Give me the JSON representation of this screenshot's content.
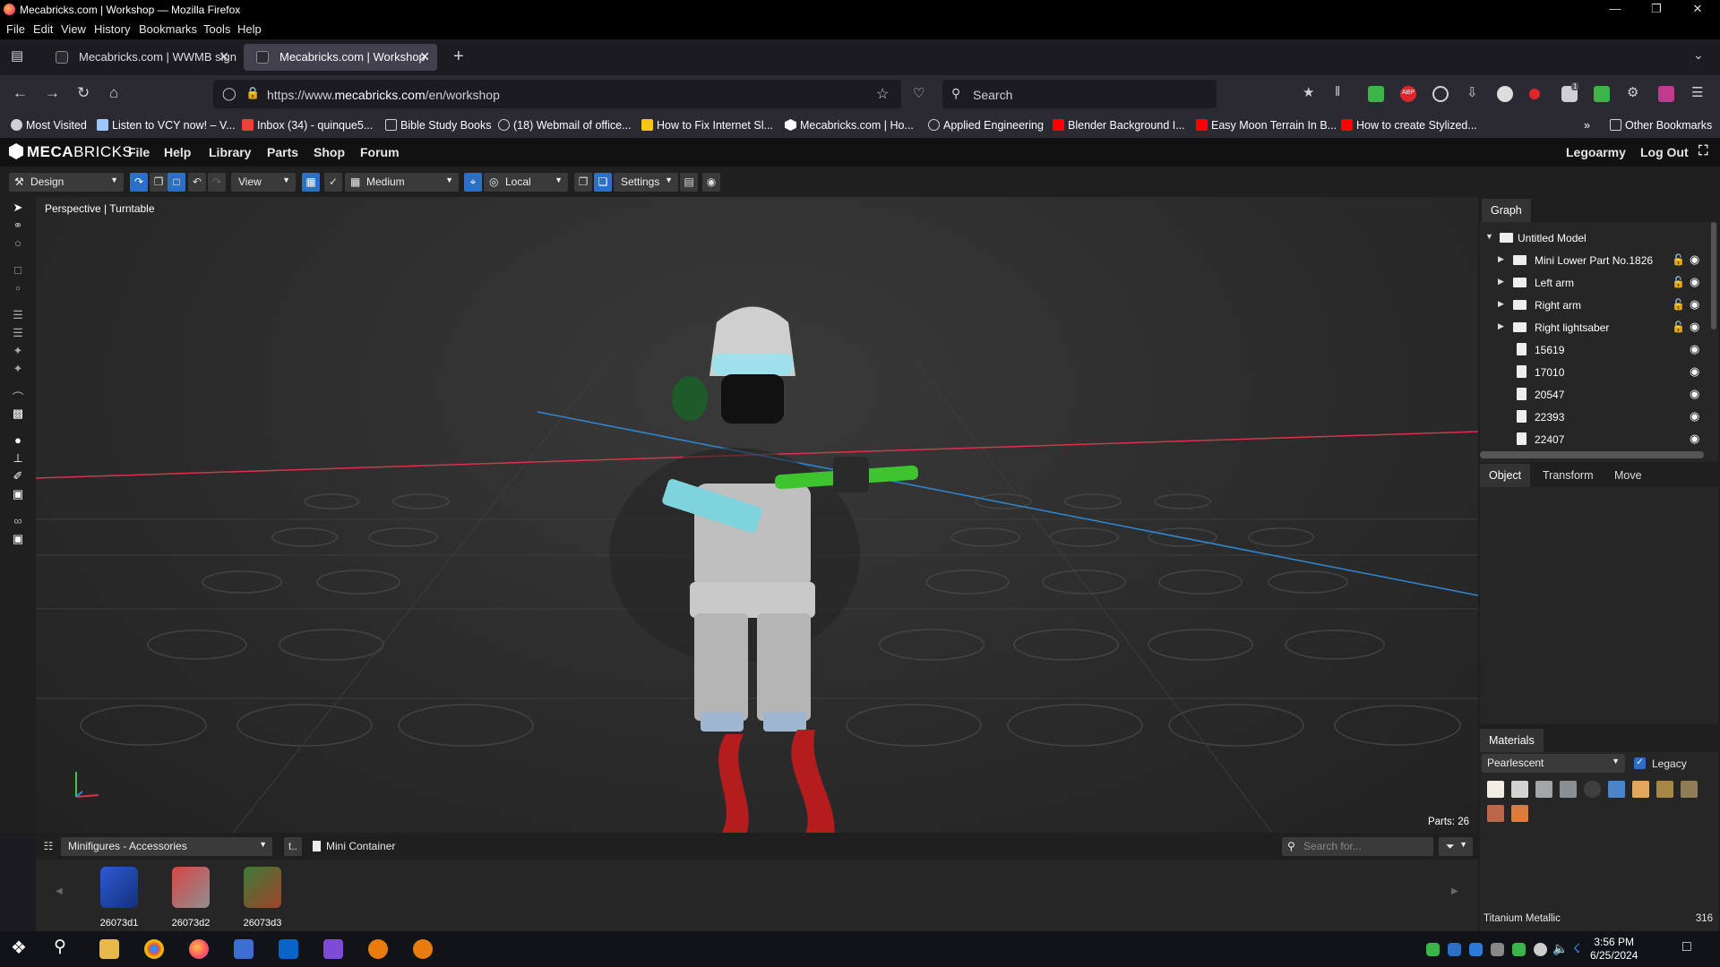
{
  "browser": {
    "window_title": "Mecabricks.com | Workshop — Mozilla Firefox",
    "menu": [
      "File",
      "Edit",
      "View",
      "History",
      "Bookmarks",
      "Tools",
      "Help"
    ],
    "tabs": [
      {
        "label": "Mecabricks.com | WWMB sign",
        "active": false
      },
      {
        "label": "Mecabricks.com | Workshop",
        "active": true
      }
    ],
    "url_prefix": "https://www.",
    "url_domain": "mecabricks.com",
    "url_path": "/en/workshop",
    "search_placeholder": "Search",
    "toolbar_badge": "1",
    "bookmarks": [
      {
        "label": "Most Visited",
        "icon": "gear-icon",
        "color": "#cfcfd8"
      },
      {
        "label": "Listen to VCY now! – V...",
        "icon": "radio-icon",
        "color": "#9ec6ff"
      },
      {
        "label": "Inbox (34) - quinque5...",
        "icon": "gmail-icon",
        "color": "#ea4335"
      },
      {
        "label": "Bible Study Books",
        "icon": "folder-icon",
        "color": "#cfcfd8"
      },
      {
        "label": "(18) Webmail of office...",
        "icon": "globe-icon",
        "color": "#cfcfd8"
      },
      {
        "label": "How to Fix Internet Sl...",
        "icon": "page-icon",
        "color": "#f5c518"
      },
      {
        "label": "Mecabricks.com | Ho...",
        "icon": "hex-icon",
        "color": "#2b2a33"
      },
      {
        "label": "Applied Engineering",
        "icon": "globe-icon",
        "color": "#cfcfd8"
      },
      {
        "label": "Blender Background I...",
        "icon": "youtube-icon",
        "color": "#ff0000"
      },
      {
        "label": "Easy Moon Terrain In B...",
        "icon": "youtube-icon",
        "color": "#ff0000"
      },
      {
        "label": "How to create Stylized...",
        "icon": "youtube-icon",
        "color": "#ff0000"
      }
    ],
    "other_bookmarks": "Other Bookmarks"
  },
  "mecabricks": {
    "brand": "MECA",
    "brand_thin": "BRICKS",
    "menu": [
      "File",
      "Help",
      "Library",
      "Parts",
      "Shop",
      "Forum"
    ],
    "user": "Legoarmy",
    "logout": "Log Out",
    "toolbar": {
      "mode": "Design",
      "view": "View",
      "quality": "Medium",
      "space": "Local",
      "settings": "Settings"
    },
    "viewport": {
      "label": "Perspective | Turntable",
      "parts_count": "Parts: 26"
    },
    "graph": {
      "tab": "Graph",
      "rows": [
        {
          "label": "Untitled Model",
          "kind": "root"
        },
        {
          "label": "Mini Lower Part No.1826",
          "kind": "group"
        },
        {
          "label": "Left arm",
          "kind": "group"
        },
        {
          "label": "Right arm",
          "kind": "group"
        },
        {
          "label": "Right lightsaber",
          "kind": "group"
        },
        {
          "label": "15619",
          "kind": "part"
        },
        {
          "label": "17010",
          "kind": "part"
        },
        {
          "label": "20547",
          "kind": "part"
        },
        {
          "label": "22393",
          "kind": "part"
        },
        {
          "label": "22407",
          "kind": "part"
        }
      ]
    },
    "object_tabs": [
      "Object",
      "Transform",
      "Move"
    ],
    "materials": {
      "tab": "Materials",
      "type": "Pearlescent",
      "legacy": "Legacy",
      "legacy_checked": true,
      "swatches": [
        "#f2ede4",
        "#d3d3cf",
        "#a3a6a8",
        "#8a8f93",
        "#3f3f3f",
        "#4a85c9",
        "#e2a75c",
        "#a58843",
        "#8e7d57",
        "#b9664a",
        "#e07a3a"
      ],
      "selected_name": "Titanium Metallic",
      "selected_id": "316"
    },
    "parts": {
      "category": "Minifigures - Accessories",
      "container": "Mini Container",
      "search_placeholder": "Search for...",
      "items": [
        {
          "id": "26073d1",
          "color": "#1f43a8"
        },
        {
          "id": "26073d2",
          "color": "#c23a3a"
        },
        {
          "id": "26073d3",
          "color": "#b0502a"
        }
      ]
    }
  },
  "taskbar": {
    "time": "3:56 PM",
    "date": "6/25/2024"
  }
}
